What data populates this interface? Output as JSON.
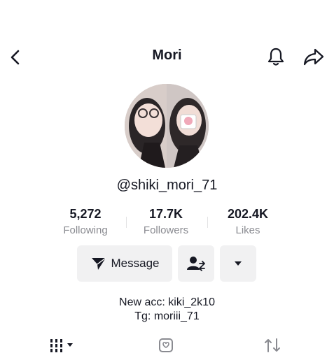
{
  "header": {
    "title": "Mori",
    "back_icon": "chevron-left-icon",
    "bell_icon": "bell-icon",
    "share_icon": "share-icon"
  },
  "profile": {
    "username": "@shiki_mori_71",
    "avatar_icon": "avatar-photo"
  },
  "stats": [
    {
      "value": "5,272",
      "label": "Following"
    },
    {
      "value": "17.7K",
      "label": "Followers"
    },
    {
      "value": "202.4K",
      "label": "Likes"
    }
  ],
  "actions": {
    "message_label": "Message",
    "message_icon": "send-icon",
    "follow_icon": "add-friend-icon",
    "more_icon": "caret-down-icon"
  },
  "bio": {
    "line1": "New acc: kiki_2k10",
    "line2": "Tg: moriii_71"
  },
  "tabs": {
    "videos_icon": "grid-icon",
    "favorites_icon": "liked-icon",
    "reposts_icon": "repost-icon"
  }
}
